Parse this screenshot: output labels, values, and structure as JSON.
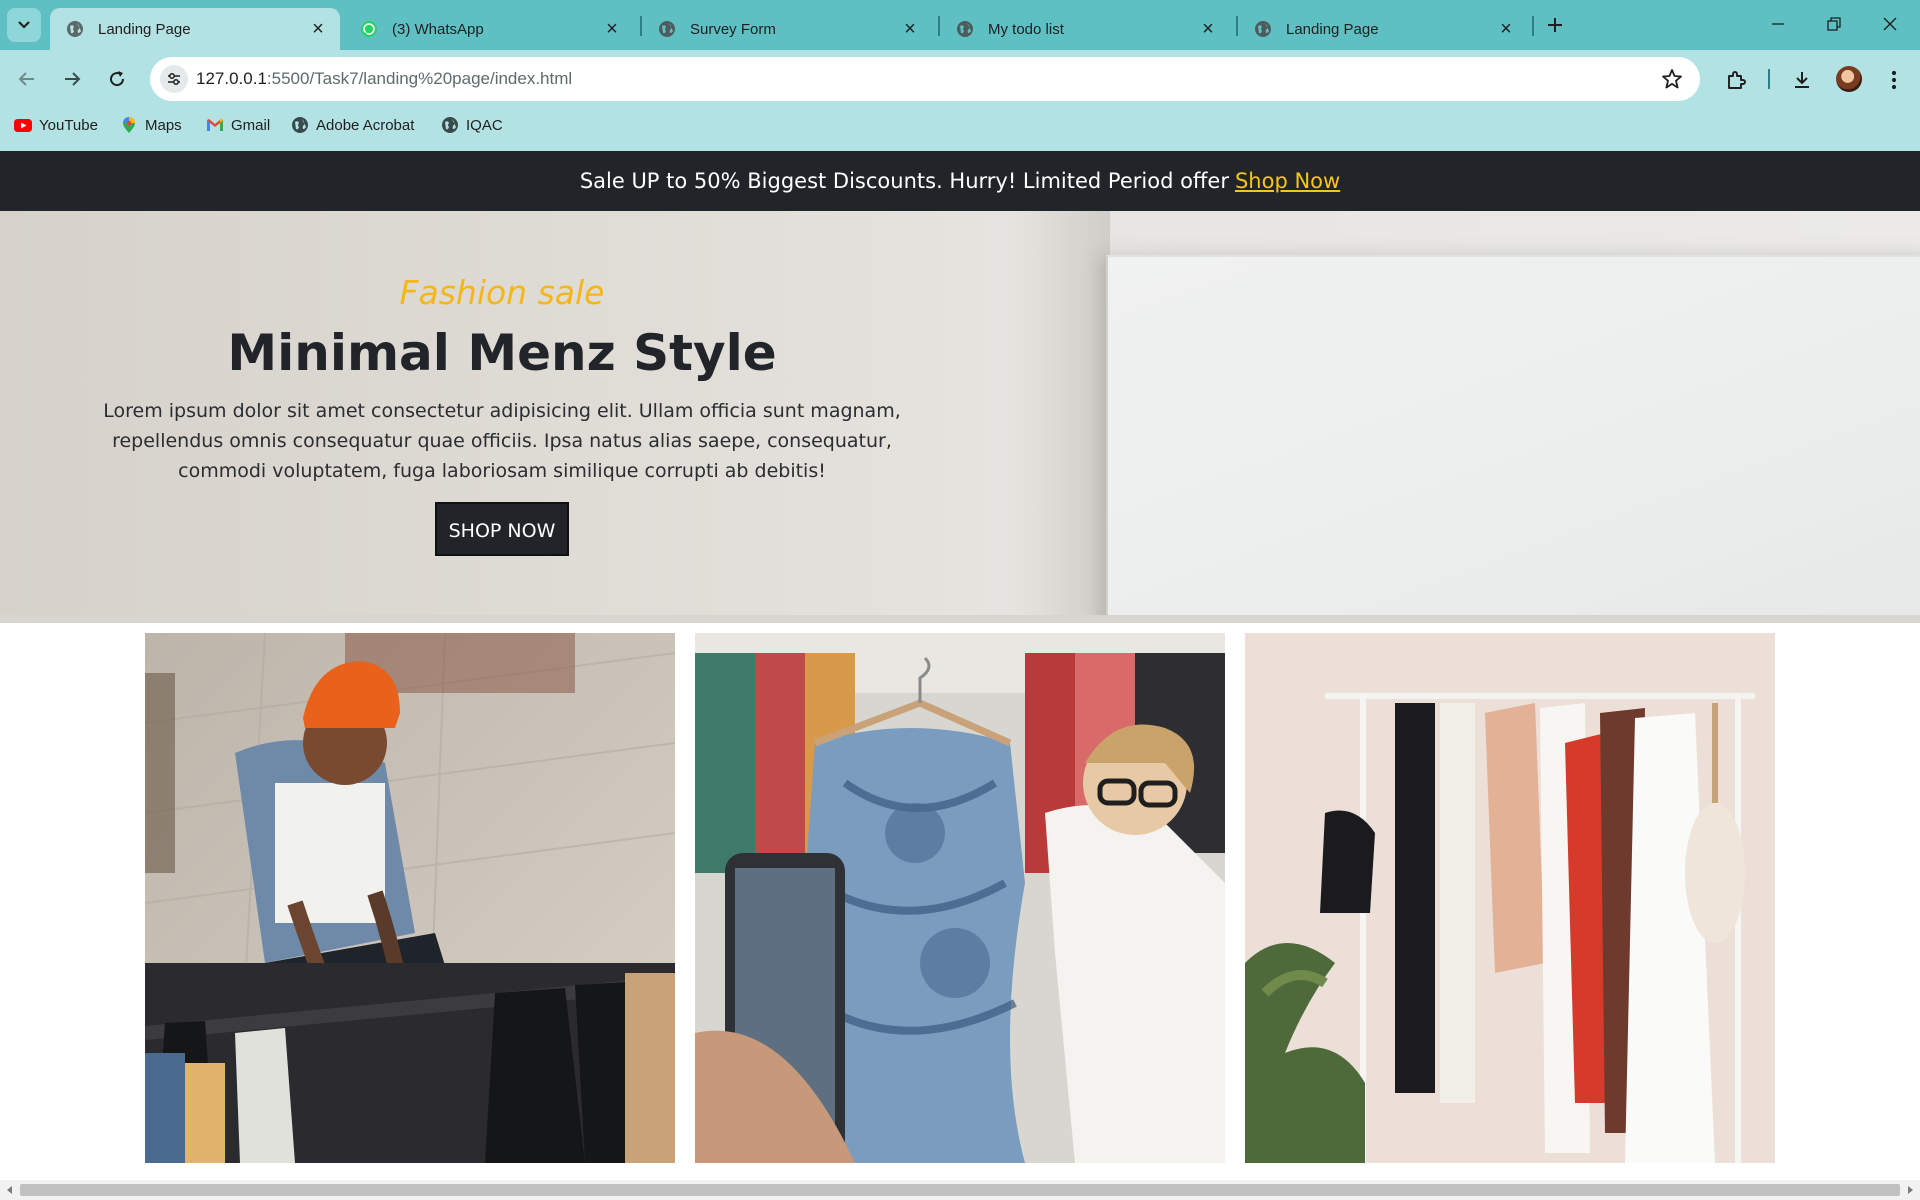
{
  "browser": {
    "tabs": [
      {
        "title": "Landing Page",
        "favicon": "globe-icon",
        "active": true
      },
      {
        "title": "(3) WhatsApp",
        "favicon": "whatsapp-icon",
        "active": false
      },
      {
        "title": "Survey Form",
        "favicon": "globe-icon",
        "active": false
      },
      {
        "title": "My todo list",
        "favicon": "globe-icon",
        "active": false
      },
      {
        "title": "Landing Page",
        "favicon": "globe-icon",
        "active": false
      }
    ],
    "url": {
      "host": "127.0.0.1",
      "rest": ":5500/Task7/landing%20page/index.html"
    },
    "bookmarks": [
      {
        "label": "YouTube",
        "icon": "youtube-icon"
      },
      {
        "label": "Maps",
        "icon": "maps-icon"
      },
      {
        "label": "Gmail",
        "icon": "gmail-icon"
      },
      {
        "label": "Adobe Acrobat",
        "icon": "globe-icon"
      },
      {
        "label": "IQAC",
        "icon": "globe-icon"
      }
    ],
    "colors": {
      "tab_strip": "#5fc0c4",
      "toolbar": "#b3e2e4"
    }
  },
  "page": {
    "announcement": {
      "text": "Sale UP to 50% Biggest Discounts. Hurry! Limited Period offer",
      "link": "Shop Now"
    },
    "hero": {
      "kicker": "Fashion sale",
      "title": "Minimal Menz Style",
      "description": "Lorem ipsum dolor sit amet consectetur adipisicing elit. Ullam officia sunt magnam, repellendus omnis consequatur quae officiis. Ipsa natus alias saepe, consequatur, commodi voluptatem, fuga laboriosam similique corrupti ab debitis!",
      "button": "SHOP NOW"
    },
    "gallery": [
      {
        "icon": "photo-man-browsing-rack"
      },
      {
        "icon": "photo-woman-holding-dress"
      },
      {
        "icon": "photo-clothing-rack"
      }
    ],
    "colors": {
      "dark": "#212529",
      "accent": "#f5b618",
      "link": "#f5c518"
    }
  }
}
